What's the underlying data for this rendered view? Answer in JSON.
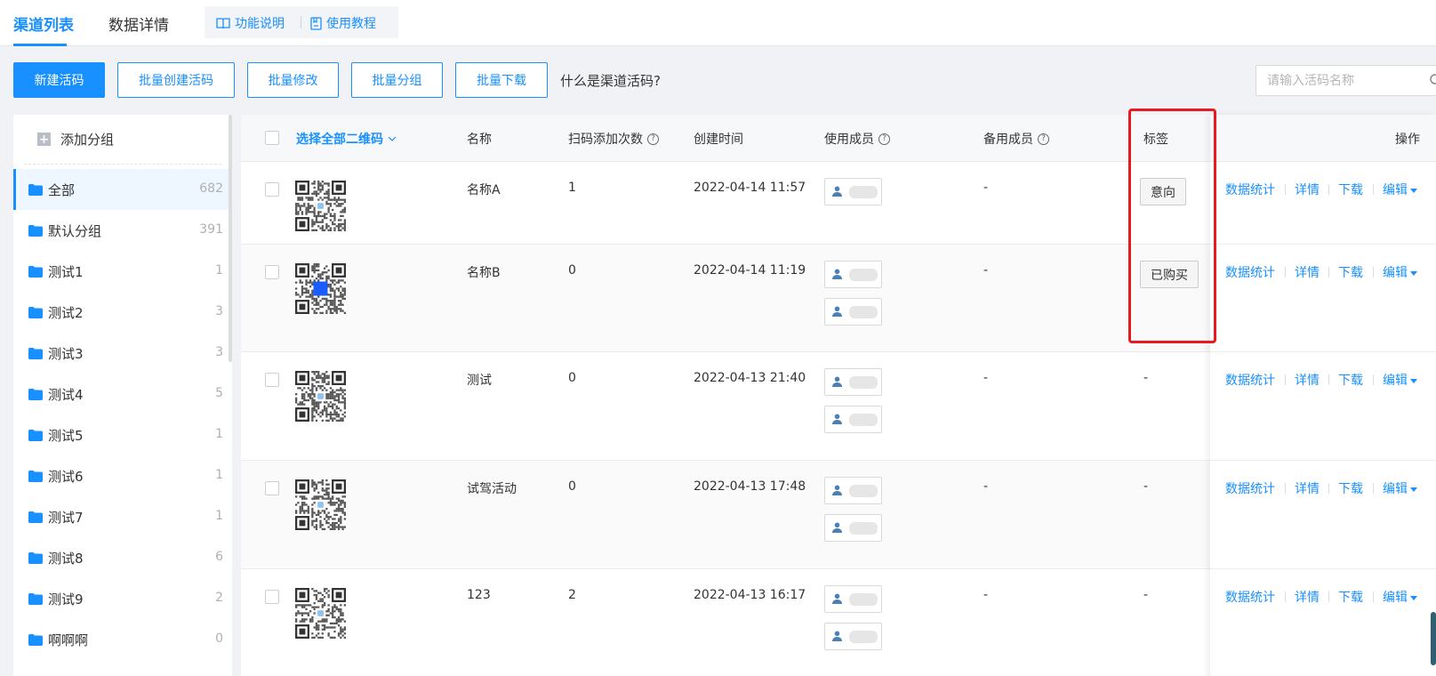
{
  "top_tabs": [
    "渠道列表",
    "数据详情"
  ],
  "help_links": [
    "功能说明",
    "使用教程"
  ],
  "toolbar": {
    "buttons": [
      "新建活码",
      "批量创建活码",
      "批量修改",
      "批量分组",
      "批量下载"
    ],
    "question_link": "什么是渠道活码?",
    "search_placeholder": "请输入活码名称"
  },
  "sidebar": {
    "add_group": "添加分组",
    "groups": [
      {
        "label": "全部",
        "count": "682",
        "active": true
      },
      {
        "label": "默认分组",
        "count": "391"
      },
      {
        "label": "测试1",
        "count": "1"
      },
      {
        "label": "测试2",
        "count": "3"
      },
      {
        "label": "测试3",
        "count": "3"
      },
      {
        "label": "测试4",
        "count": "5"
      },
      {
        "label": "测试5",
        "count": "1"
      },
      {
        "label": "测试6",
        "count": "1"
      },
      {
        "label": "测试7",
        "count": "1"
      },
      {
        "label": "测试8",
        "count": "6"
      },
      {
        "label": "测试9",
        "count": "2"
      },
      {
        "label": "啊啊啊",
        "count": "0"
      }
    ]
  },
  "table": {
    "headers": {
      "select_all": "选择全部二维码",
      "name": "名称",
      "scan_count": "扫码添加次数",
      "created": "创建时间",
      "members": "使用成员",
      "backup": "备用成员",
      "tags": "标签",
      "actions": "操作"
    },
    "rows": [
      {
        "name": "名称A",
        "scan": "1",
        "created": "2022-04-14 11:57",
        "backup": "-",
        "tag": "意向"
      },
      {
        "name": "名称B",
        "scan": "0",
        "created": "2022-04-14 11:19",
        "backup": "-",
        "tag": "已购买"
      },
      {
        "name": "测试",
        "scan": "0",
        "created": "2022-04-13 21:40",
        "backup": "-",
        "tag": "-"
      },
      {
        "name": "试驾活动",
        "scan": "0",
        "created": "2022-04-13 17:48",
        "backup": "-",
        "tag": "-"
      },
      {
        "name": "123",
        "scan": "2",
        "created": "2022-04-13 16:17",
        "backup": "-",
        "tag": "-"
      }
    ],
    "row_actions": [
      "数据统计",
      "详情",
      "下载",
      "编辑"
    ]
  },
  "colors": {
    "accent": "#1890ff",
    "highlight": "#e8191f"
  }
}
